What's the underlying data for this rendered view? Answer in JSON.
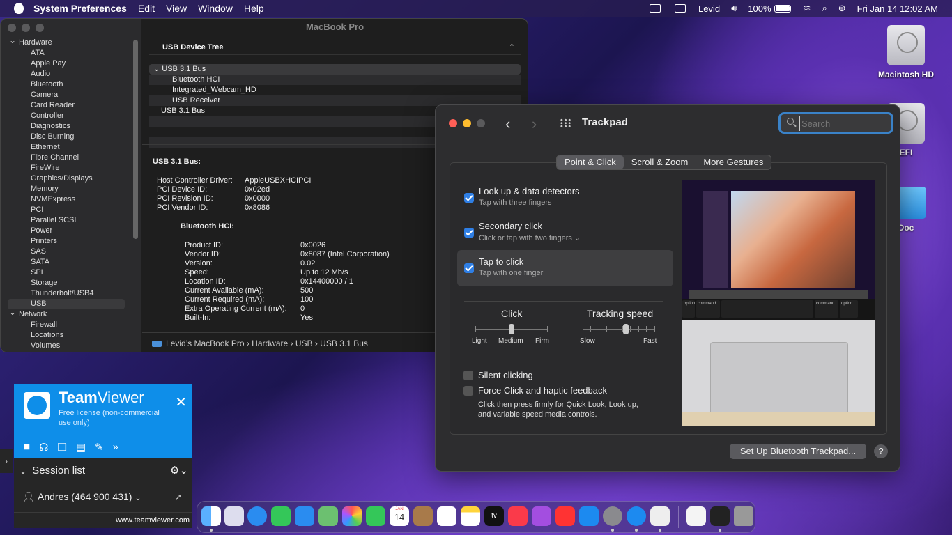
{
  "menubar": {
    "app_name": "System Preferences",
    "menus": [
      "Edit",
      "View",
      "Window",
      "Help"
    ],
    "user": "Levid",
    "battery": "100%",
    "datetime": "Fri Jan 14  12:02 AM"
  },
  "desktop": {
    "icons": [
      "Macintosh HD",
      "EFI",
      "Doc"
    ]
  },
  "sysinfo": {
    "title": "MacBook Pro",
    "tree_header": "USB Device Tree",
    "sidebar": [
      {
        "group": "Hardware"
      },
      {
        "item": "ATA"
      },
      {
        "item": "Apple Pay"
      },
      {
        "item": "Audio"
      },
      {
        "item": "Bluetooth"
      },
      {
        "item": "Camera"
      },
      {
        "item": "Card Reader"
      },
      {
        "item": "Controller"
      },
      {
        "item": "Diagnostics"
      },
      {
        "item": "Disc Burning"
      },
      {
        "item": "Ethernet"
      },
      {
        "item": "Fibre Channel"
      },
      {
        "item": "FireWire"
      },
      {
        "item": "Graphics/Displays"
      },
      {
        "item": "Memory"
      },
      {
        "item": "NVMExpress"
      },
      {
        "item": "PCI"
      },
      {
        "item": "Parallel SCSI"
      },
      {
        "item": "Power"
      },
      {
        "item": "Printers"
      },
      {
        "item": "SAS"
      },
      {
        "item": "SATA"
      },
      {
        "item": "SPI"
      },
      {
        "item": "Storage"
      },
      {
        "item": "Thunderbolt/USB4"
      },
      {
        "item": "USB",
        "selected": true
      },
      {
        "group": "Network"
      },
      {
        "item": "Firewall"
      },
      {
        "item": "Locations"
      },
      {
        "item": "Volumes"
      }
    ],
    "usb_tree": [
      {
        "label": "USB 3.1 Bus",
        "level": 0,
        "expanded": true
      },
      {
        "label": "Bluetooth HCI",
        "level": 1
      },
      {
        "label": "Integrated_Webcam_HD",
        "level": 1
      },
      {
        "label": "USB Receiver",
        "level": 1
      },
      {
        "label": "USB 3.1 Bus",
        "level": 0
      }
    ],
    "detail_heading": "USB 3.1 Bus:",
    "bus_props": [
      {
        "k": "Host Controller Driver:",
        "v": "AppleUSBXHCIPCI"
      },
      {
        "k": "PCI Device ID:",
        "v": "0x02ed"
      },
      {
        "k": "PCI Revision ID:",
        "v": "0x0000"
      },
      {
        "k": "PCI Vendor ID:",
        "v": "0x8086"
      }
    ],
    "sub_heading": "Bluetooth HCI:",
    "hci_props": [
      {
        "k": "Product ID:",
        "v": "0x0026"
      },
      {
        "k": "Vendor ID:",
        "v": "0x8087  (Intel Corporation)"
      },
      {
        "k": "Version:",
        "v": "0.02"
      },
      {
        "k": "Speed:",
        "v": "Up to 12 Mb/s"
      },
      {
        "k": "Location ID:",
        "v": "0x14400000 / 1"
      },
      {
        "k": "Current Available (mA):",
        "v": "500"
      },
      {
        "k": "Current Required (mA):",
        "v": "100"
      },
      {
        "k": "Extra Operating Current (mA):",
        "v": "0"
      },
      {
        "k": "Built-In:",
        "v": "Yes"
      }
    ],
    "path": "Levid’s MacBook Pro  ›  Hardware  ›  USB  ›  USB 3.1 Bus"
  },
  "trackpad": {
    "title": "Trackpad",
    "search_placeholder": "Search",
    "tabs": [
      "Point & Click",
      "Scroll & Zoom",
      "More Gestures"
    ],
    "options": [
      {
        "title": "Look up & data detectors",
        "sub": "Tap with three fingers",
        "checked": true
      },
      {
        "title": "Secondary click",
        "sub": "Click or tap with two fingers ⌄",
        "checked": true
      },
      {
        "title": "Tap to click",
        "sub": "Tap with one finger",
        "checked": true
      }
    ],
    "click": {
      "label": "Click",
      "min": "Light",
      "mid": "Medium",
      "max": "Firm",
      "value": 0.5
    },
    "tracking": {
      "label": "Tracking speed",
      "min": "Slow",
      "max": "Fast",
      "value": 0.6
    },
    "silent": {
      "title": "Silent clicking",
      "checked": false
    },
    "force": {
      "title": "Force Click and haptic feedback",
      "desc1": "Click then press firmly for Quick Look, Look up,",
      "desc2": "and variable speed media controls.",
      "checked": false
    },
    "setup_button": "Set Up Bluetooth Trackpad...",
    "help": "?",
    "preview_keys": [
      "option",
      "command",
      "command",
      "option"
    ]
  },
  "teamviewer": {
    "brand_bold": "Team",
    "brand_light": "Viewer",
    "license": "Free license (non-commercial use only)",
    "session_list": "Session list",
    "contact": "Andres (464 900 431)",
    "url": "www.teamviewer.com"
  },
  "dock": {
    "calendar_month": "JAN",
    "calendar_day": "14",
    "tv_label": "tv"
  }
}
